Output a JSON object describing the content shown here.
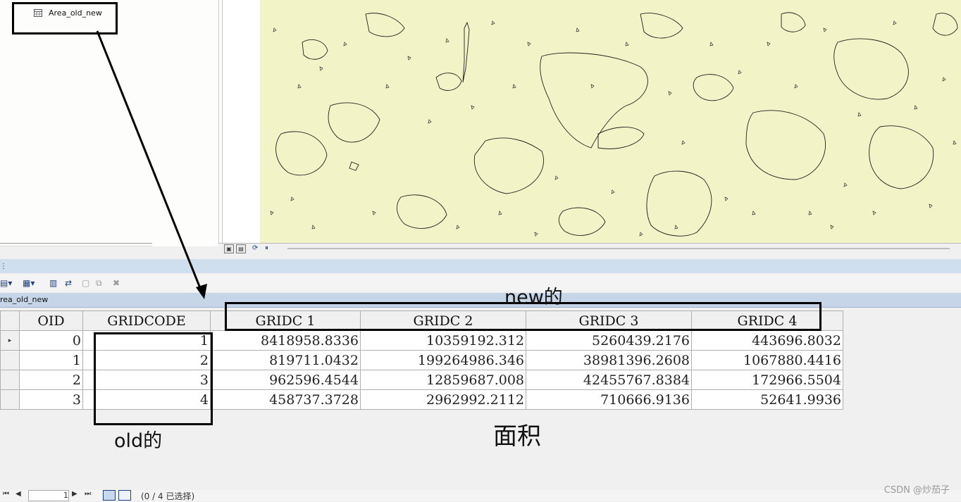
{
  "toc": {
    "table_item": "Area_old_new"
  },
  "table_window": {
    "title": "rea_old_new",
    "columns": [
      "OID",
      "GRIDCODE",
      "GRIDC 1",
      "GRIDC 2",
      "GRIDC 3",
      "GRIDC 4"
    ],
    "rows": [
      [
        "0",
        "1",
        "8418958.8336",
        "10359192.312",
        "5260439.2176",
        "443696.8032"
      ],
      [
        "1",
        "2",
        "819711.0432",
        "199264986.346",
        "38981396.2608",
        "1067880.4416"
      ],
      [
        "2",
        "3",
        "962596.4544",
        "12859687.008",
        "42455767.8384",
        "172966.5504"
      ],
      [
        "3",
        "4",
        "458737.3728",
        "2962992.2112",
        "710666.9136",
        "52641.9936"
      ]
    ],
    "status": {
      "record": "1",
      "selected_text": "(0 / 4 已选择)"
    }
  },
  "annotations": {
    "new_label": "new的",
    "old_label": "old的",
    "area_label": "面积"
  },
  "watermark": "CSDN @炒茄子",
  "colors": {
    "map_fill": "#f2f3c6",
    "header_bar": "#cfdfee",
    "tab_strip": "#c6d6e8"
  }
}
